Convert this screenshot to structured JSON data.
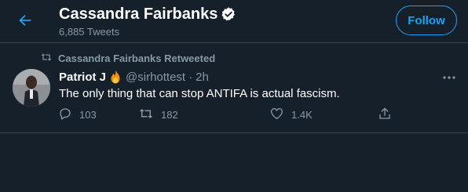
{
  "header": {
    "title": "Cassandra Fairbanks",
    "tweet_count": "6,885 Tweets",
    "follow_label": "Follow"
  },
  "retweet_banner": {
    "label": "Cassandra Fairbanks Retweeted",
    "icon": "retweet-icon"
  },
  "tweet": {
    "author_name": "Patriot J",
    "author_emoji": "fire-icon",
    "handle": "@sirhottest",
    "separator": "·",
    "time": "2h",
    "text": "The only thing that can stop ANTIFA is actual fascism.",
    "replies": "103",
    "retweets": "182",
    "likes": "1.4K"
  },
  "colors": {
    "background": "#15202b",
    "accent": "#1da1f2",
    "muted": "#8899a6",
    "divider": "#38444d"
  }
}
